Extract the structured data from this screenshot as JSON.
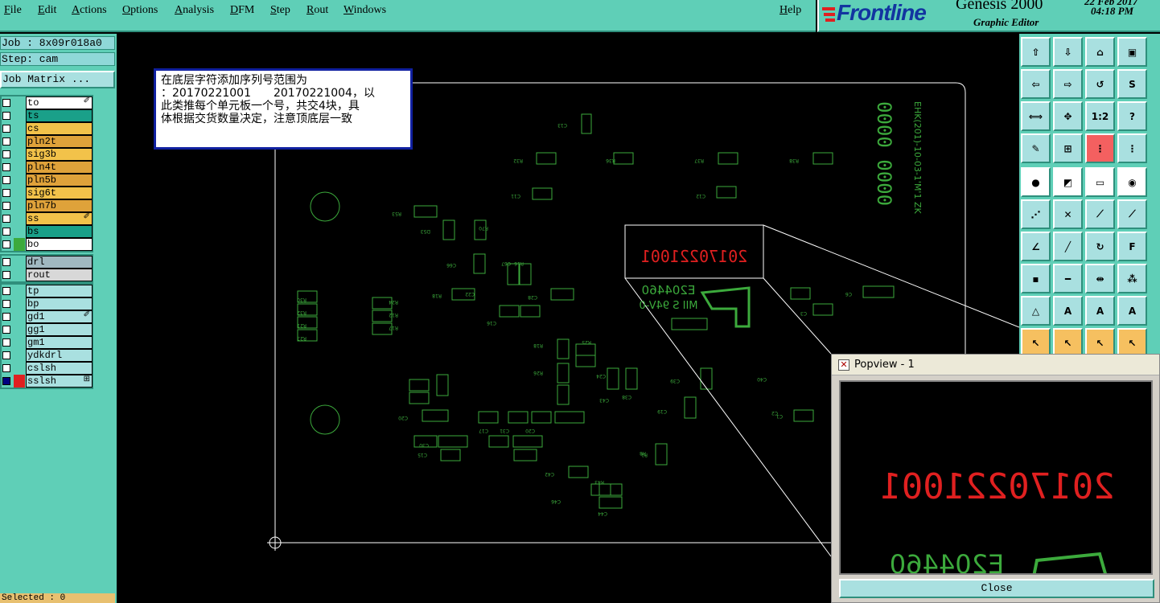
{
  "menu": {
    "items": [
      "File",
      "Edit",
      "Actions",
      "Options",
      "Analysis",
      "DFM",
      "Step",
      "Rout",
      "Windows"
    ],
    "help": "Help"
  },
  "brand": {
    "logo": "Frontline",
    "product": "Genesis 2000",
    "subtitle": "Graphic Editor",
    "date": "22 Feb 2017",
    "time": "04:18 PM"
  },
  "left_panel": {
    "job": "Job : 8x09r018a0",
    "step": "Step: cam",
    "job_matrix_button": "Job Matrix ...",
    "groups": [
      [
        {
          "name": "to",
          "color": "#ffffff",
          "checked": false,
          "mark": "✐"
        },
        {
          "name": "ts",
          "color": "#1aa089",
          "checked": false,
          "mark": ""
        },
        {
          "name": "cs",
          "color": "#f2c24a",
          "checked": false,
          "mark": ""
        },
        {
          "name": "pln2t",
          "color": "#dfa23a",
          "checked": false,
          "mark": ""
        },
        {
          "name": "sig3b",
          "color": "#f2c24a",
          "checked": false,
          "mark": ""
        },
        {
          "name": "pln4t",
          "color": "#dfa23a",
          "checked": false,
          "mark": ""
        },
        {
          "name": "pln5b",
          "color": "#dfa23a",
          "checked": false,
          "mark": ""
        },
        {
          "name": "sig6t",
          "color": "#f2c24a",
          "checked": false,
          "mark": ""
        },
        {
          "name": "pln7b",
          "color": "#dfa23a",
          "checked": false,
          "mark": ""
        },
        {
          "name": "ss",
          "color": "#f2c24a",
          "checked": false,
          "mark": "✐"
        },
        {
          "name": "bs",
          "color": "#1aa089",
          "checked": false,
          "mark": ""
        },
        {
          "name": "bo",
          "color": "#ffffff",
          "checked": false,
          "swatch": "#3caa3c",
          "mark": ""
        }
      ],
      [
        {
          "name": "drl",
          "color": "#a0b8c0",
          "checked": false,
          "mark": ""
        },
        {
          "name": "rout",
          "color": "#d8d8d8",
          "checked": false,
          "mark": ""
        }
      ],
      [
        {
          "name": "tp",
          "color": "#a9e0e0",
          "checked": false,
          "mark": ""
        },
        {
          "name": "bp",
          "color": "#a9e0e0",
          "checked": false,
          "mark": ""
        },
        {
          "name": "gd1",
          "color": "#a9e0e0",
          "checked": false,
          "mark": "✐"
        },
        {
          "name": "gg1",
          "color": "#a9e0e0",
          "checked": false,
          "mark": ""
        },
        {
          "name": "gm1",
          "color": "#a9e0e0",
          "checked": false,
          "mark": ""
        },
        {
          "name": "ydkdrl",
          "color": "#a9e0e0",
          "checked": false,
          "mark": ""
        },
        {
          "name": "cslsh",
          "color": "#a9e0e0",
          "checked": false,
          "mark": ""
        },
        {
          "name": "sslsh",
          "color": "#a9e0e0",
          "checked": true,
          "swatch": "#e02020",
          "mark": "⊞"
        }
      ]
    ],
    "selected": "Selected : 0"
  },
  "note": {
    "lines": [
      "在底层字符添加序列号范围为",
      "：20170221001　　20170221004，以",
      "此类推每个单元板一个号，共交4块，具",
      "体根据交货数量决定，注意顶底层一致"
    ]
  },
  "board": {
    "serial_number": "20170221001",
    "part_number": "E204460",
    "marking": "MII S 94V-0",
    "side_text": "EHK(201)-10-03-1'M'1 ZK",
    "side_code": "0000 0000",
    "component_labels": [
      "C13",
      "R32",
      "R36",
      "R37",
      "R38",
      "C11",
      "C12",
      "R53",
      "D53",
      "R70",
      "C66",
      "C67",
      "R16",
      "R18",
      "C22",
      "C28",
      "C16",
      "R30",
      "R32",
      "R21",
      "R23",
      "R24",
      "R12",
      "R17",
      "R18",
      "R26",
      "R25",
      "C24",
      "C43",
      "C39",
      "C38",
      "C40",
      "C19",
      "C17",
      "C31",
      "C20",
      "C20",
      "C15",
      "C30",
      "C42",
      "C46",
      "R43",
      "C44",
      "R8",
      "C2",
      "C6",
      "C3",
      "C1",
      "R1"
    ]
  },
  "toolbar": {
    "labels": [
      "1:2",
      "?"
    ]
  },
  "popview": {
    "title": "Popview - 1",
    "serial_number": "20170221001",
    "part_number": "E204460",
    "close_button": "Close"
  },
  "colors": {
    "ui_teal": "#5fcfb7",
    "silkscreen_green": "#3caa3c",
    "serial_red": "#e02020",
    "board_outline": "#ffffff"
  }
}
